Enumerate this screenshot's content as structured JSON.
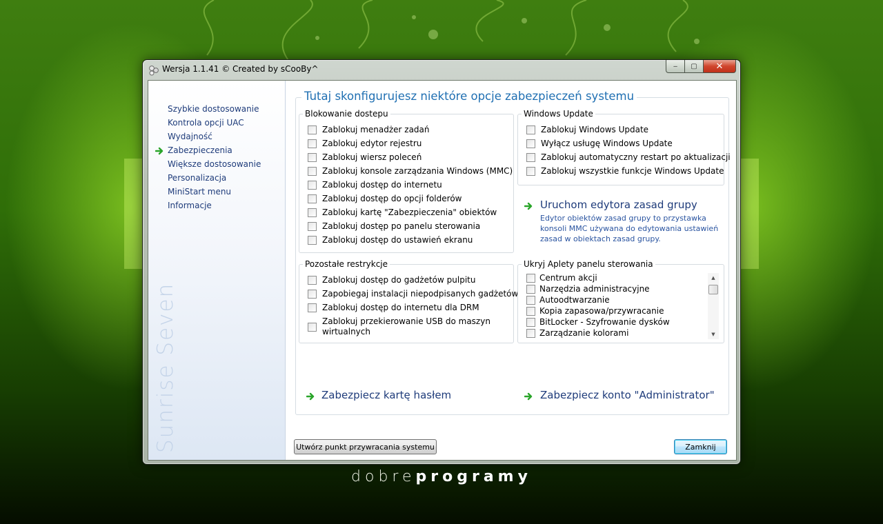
{
  "window": {
    "title": "Wersja 1.1.41 © Created by sCooBy^",
    "caption_buttons": {
      "minimize": "‒",
      "maximize": "▢",
      "close": "✕"
    }
  },
  "sidebar": {
    "items": [
      {
        "label": "Szybkie dostosowanie"
      },
      {
        "label": "Kontrola opcji UAC"
      },
      {
        "label": "Wydajność"
      },
      {
        "label": "Zabezpieczenia",
        "selected": true
      },
      {
        "label": "Większe dostosowanie"
      },
      {
        "label": "Personalizacja"
      },
      {
        "label": "MiniStart menu"
      },
      {
        "label": "Informacje"
      }
    ],
    "brand": "Sunrise Seven"
  },
  "main": {
    "title": "Tutaj skonfigurujesz niektóre opcje zabezpieczeń systemu",
    "groups": {
      "blokowanie": {
        "title": "Blokowanie dostepu",
        "items": [
          "Zablokuj menadżer zadań",
          "Zablokuj edytor rejestru",
          "Zablokuj wiersz poleceń",
          "Zablokuj konsole zarządzania Windows (MMC)",
          "Zablokuj dostęp do internetu",
          "Zablokuj dostęp do opcji folderów",
          "Zablokuj kartę \"Zabezpieczenia\" obiektów",
          "Zablokuj dostęp po panelu sterowania",
          "Zablokuj dostęp do ustawień ekranu"
        ]
      },
      "windows_update": {
        "title": "Windows Update",
        "items": [
          "Zablokuj Windows Update",
          "Wyłącz usługę Windows Update",
          "Zablokuj automatyczny restart po aktualizacji",
          "Zablokuj wszystkie funkcje Windows Update"
        ]
      },
      "pozostale": {
        "title": "Pozostałe restrykcje",
        "items": [
          "Zablokuj dostęp do gadżetów pulpitu",
          "Zapobiegaj instalacji niepodpisanych gadżetów",
          "Zablokuj dostęp do internetu dla DRM",
          "Zablokuj przekierowanie USB do maszyn wirtualnych"
        ]
      },
      "aplety": {
        "title": "Ukryj Aplety panelu sterowania",
        "items": [
          "Centrum akcji",
          "Narzędzia administracyjne",
          "Autoodtwarzanie",
          "Kopia zapasowa/przywracanie",
          "BitLocker - Szyfrowanie dysków",
          "Zarządzanie kolorami"
        ]
      }
    },
    "gpedit": {
      "label": "Uruchom edytora zasad grupy",
      "description": "Edytor obiektów zasad grupy to przystawka konsoli MMC używana do edytowania ustawień zasad w obiektach zasad grupy."
    },
    "password_link": "Zabezpiecz kartę hasłem",
    "admin_link": "Zabezpiecz konto \"Administrator\""
  },
  "buttons": {
    "restore_point": "Utwórz punkt przywracania systemu",
    "close": "Zamknij"
  },
  "footer": {
    "part1": "dobre",
    "part2": "programy"
  },
  "colors": {
    "accent": "#1f6fb2",
    "link": "#1e3b7a",
    "arrow": "#2aa52a",
    "background": "#2f6e08"
  }
}
